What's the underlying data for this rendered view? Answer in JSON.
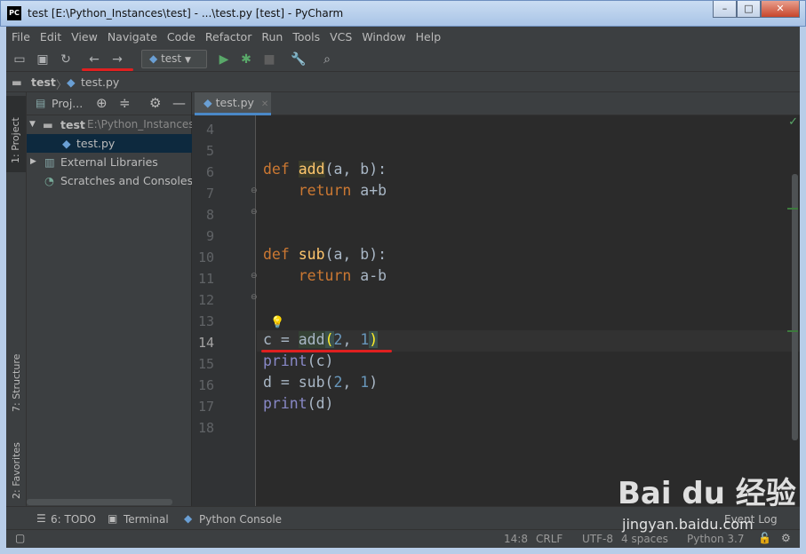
{
  "window": {
    "title": "test [E:\\Python_Instances\\test] - ...\\test.py [test] - PyCharm",
    "app_icon": "PC"
  },
  "menu": [
    "File",
    "Edit",
    "View",
    "Navigate",
    "Code",
    "Refactor",
    "Run",
    "Tools",
    "VCS",
    "Window",
    "Help"
  ],
  "toolbar": {
    "run_config": "test"
  },
  "breadcrumb": {
    "project": "test",
    "file": "test.py"
  },
  "left_tools": {
    "project": "1: Project",
    "structure": "7: Structure",
    "favorites": "2: Favorites"
  },
  "project_panel": {
    "header": "Proj...",
    "tree": [
      {
        "label": "test",
        "path": "E:\\Python_Instances\\test"
      },
      {
        "label": "test.py"
      },
      {
        "label": "External Libraries"
      },
      {
        "label": "Scratches and Consoles"
      }
    ]
  },
  "editor": {
    "tab": "test.py",
    "line_numbers": [
      "4",
      "5",
      "6",
      "7",
      "8",
      "9",
      "10",
      "11",
      "12",
      "13",
      "14",
      "15",
      "16",
      "17",
      "18"
    ],
    "code": {
      "l6": {
        "kw": "def",
        "name": "add",
        "rest": "(a, b):"
      },
      "l7": {
        "kw": "return",
        "rest": "a+b"
      },
      "l10": {
        "kw": "def",
        "name": "sub",
        "rest": "(a, b):"
      },
      "l11": {
        "kw": "return",
        "rest": "a-b"
      },
      "l14": {
        "a": "c = ",
        "fn": "add",
        "p1": "(",
        "n1": "2",
        ",": ", ",
        "n2": "1",
        "p2": ")"
      },
      "l15": {
        "fn": "print",
        "rest": "(c)"
      },
      "l16": {
        "a": "d = sub(",
        "n1": "2",
        "sep": ", ",
        "n2": "1",
        "rest": ")"
      },
      "l17": {
        "fn": "print",
        "rest": "(d)"
      }
    }
  },
  "bottom_tools": {
    "todo": "6: TODO",
    "terminal": "Terminal",
    "python_console": "Python Console",
    "event_log": "Event Log"
  },
  "status": {
    "position": "14:8",
    "line_sep": "CRLF",
    "encoding": "UTF-8",
    "indent": "4 spaces",
    "interpreter": "Python 3.7"
  },
  "watermark": {
    "brand": "Bai du 经验",
    "url": "jingyan.baidu.com"
  }
}
